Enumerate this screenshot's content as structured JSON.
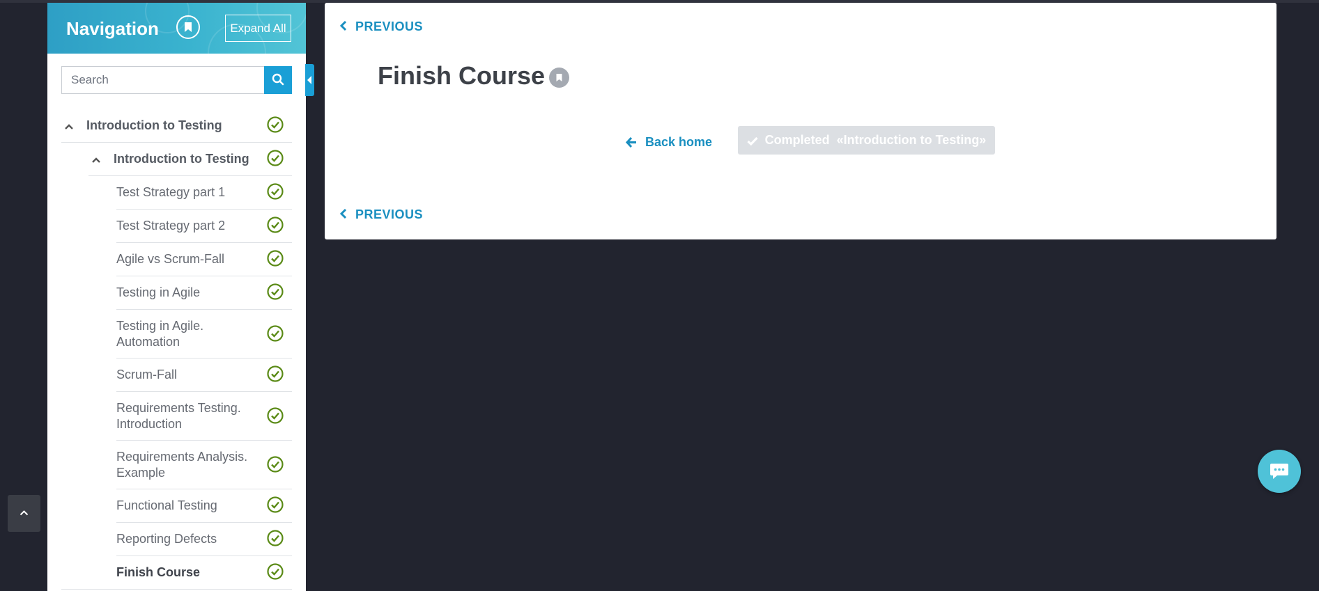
{
  "sidebar": {
    "title": "Navigation",
    "expand_all_label": "Expand All",
    "search_placeholder": "Search",
    "search_value": "",
    "items": [
      {
        "label": "Introduction to Testing",
        "level": "module",
        "expanded": true,
        "completed": true
      },
      {
        "label": "Introduction to Testing",
        "level": "section",
        "expanded": true,
        "completed": true
      },
      {
        "label": "Test Strategy part 1",
        "level": "lesson",
        "completed": true
      },
      {
        "label": "Test Strategy part 2",
        "level": "lesson",
        "completed": true
      },
      {
        "label": "Agile vs Scrum-Fall",
        "level": "lesson",
        "completed": true
      },
      {
        "label": "Testing in Agile",
        "level": "lesson",
        "completed": true
      },
      {
        "label": "Testing in Agile.",
        "label_line2": "Automation",
        "level": "lesson",
        "completed": true
      },
      {
        "label": "Scrum-Fall",
        "level": "lesson",
        "completed": true
      },
      {
        "label": "Requirements Testing.",
        "label_line2": "Introduction",
        "level": "lesson",
        "completed": true
      },
      {
        "label": "Requirements Analysis.",
        "label_line2": "Example",
        "level": "lesson",
        "completed": true
      },
      {
        "label": "Functional Testing",
        "level": "lesson",
        "completed": true
      },
      {
        "label": "Reporting Defects",
        "level": "lesson",
        "completed": true
      },
      {
        "label": "Finish Course",
        "level": "lesson",
        "completed": true,
        "current": true
      }
    ]
  },
  "main": {
    "previous_label": "PREVIOUS",
    "previous_bottom_label": "PREVIOUS",
    "title": "Finish Course",
    "back_home_label": "Back home",
    "completed_label": "Completed  «Introduction to Testing»"
  },
  "colors": {
    "page_bg": "#22242f",
    "accent": "#1a9fd6",
    "link": "#1a8fc0",
    "check_green": "#5a8a16",
    "header_gradient_start": "#2e9fc5",
    "header_gradient_end": "#52c4d6",
    "completed_button_bg": "#dcdfe3",
    "chat_bubble": "#4fc2d8"
  },
  "icons": {
    "header_bookmark": "bookmark-icon",
    "search": "search-icon",
    "item_status": "check-circle-icon",
    "expand_toggle": "chevron-up-icon",
    "sidebar_collapse": "caret-left-icon",
    "scroll_top": "chevron-up-icon",
    "previous": "chevron-left-icon",
    "back_home": "arrow-left-icon",
    "completed": "check-icon",
    "chat": "chat-bubble-icon"
  }
}
